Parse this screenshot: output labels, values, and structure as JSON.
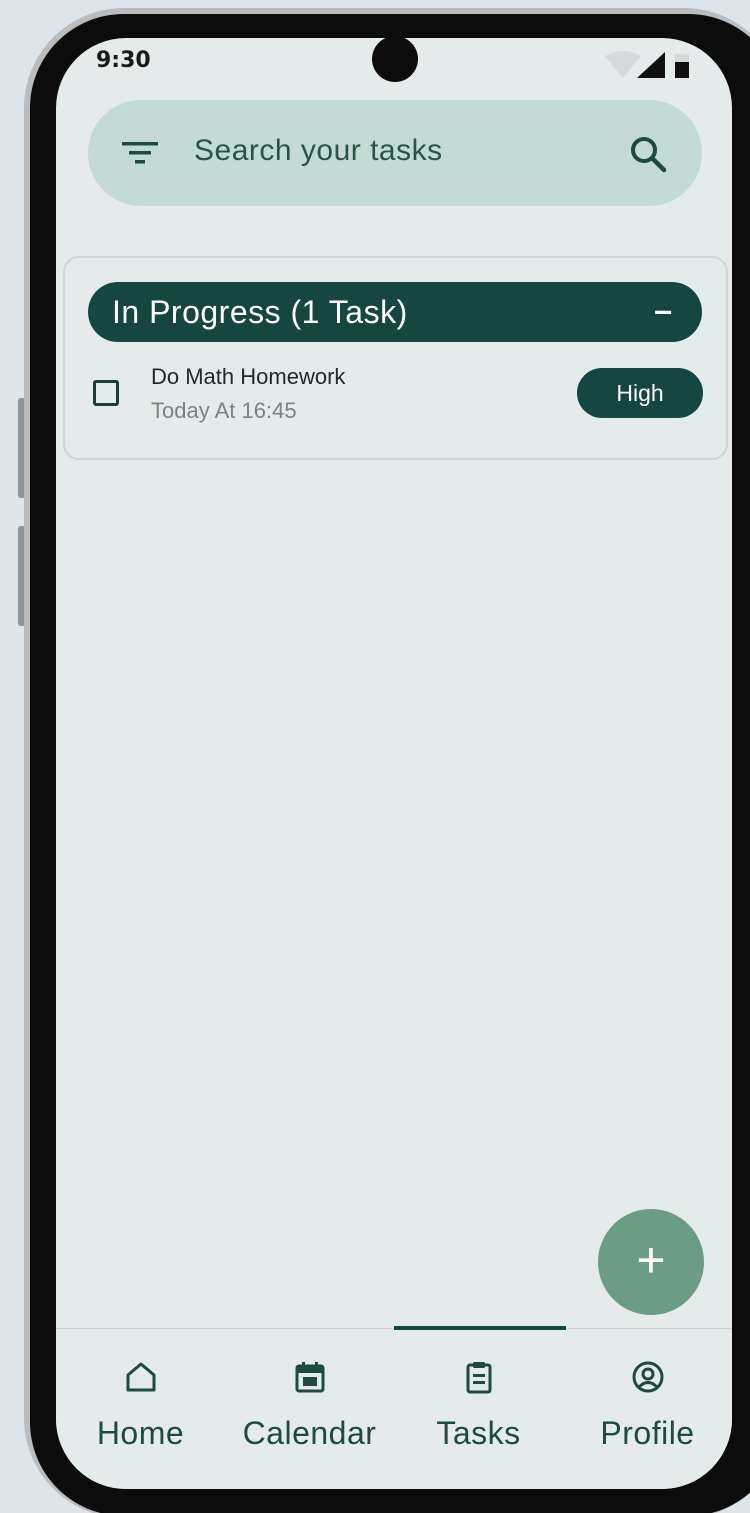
{
  "status_bar": {
    "time": "9:30",
    "icons": [
      "wifi-icon",
      "signal-icon",
      "battery-icon"
    ]
  },
  "search": {
    "placeholder": "Search your tasks",
    "filter_icon": "filter-icon",
    "search_icon": "search-icon"
  },
  "groups": [
    {
      "title": "In Progress (1 Task)",
      "toggle": "–",
      "tasks": [
        {
          "title": "Do Math Homework",
          "time": "Today At 16:45",
          "priority": "High",
          "checked": false
        }
      ]
    }
  ],
  "fab": {
    "label": "+",
    "icon": "plus-icon"
  },
  "nav": {
    "active": "Tasks",
    "items": [
      {
        "label": "Home",
        "icon": "home-icon"
      },
      {
        "label": "Calendar",
        "icon": "calendar-icon"
      },
      {
        "label": "Tasks",
        "icon": "clipboard-icon"
      },
      {
        "label": "Profile",
        "icon": "profile-icon"
      }
    ]
  },
  "colors": {
    "primary": "#154640",
    "search_bg": "#c4dad4",
    "fab": "#6a9c86",
    "screen_bg": "#e5eaea"
  }
}
